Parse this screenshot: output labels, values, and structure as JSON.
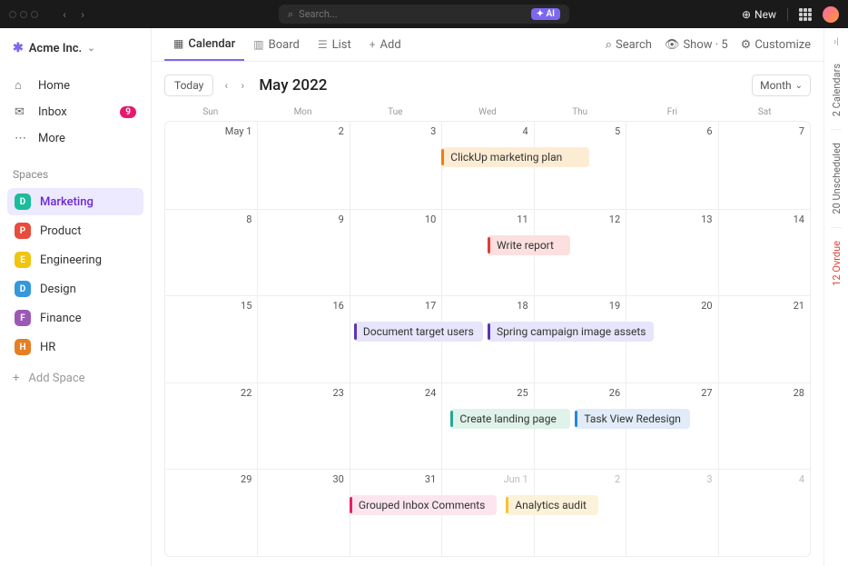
{
  "titlebar": {
    "search_placeholder": "Search...",
    "ai_label": "AI",
    "new_label": "New"
  },
  "workspace": {
    "name": "Acme Inc."
  },
  "sidebar": {
    "nav": [
      {
        "icon": "home",
        "label": "Home"
      },
      {
        "icon": "inbox",
        "label": "Inbox",
        "badge": "9"
      },
      {
        "icon": "more",
        "label": "More"
      }
    ],
    "section_label": "Spaces",
    "spaces": [
      {
        "letter": "D",
        "color": "#1abc9c",
        "label": "Marketing",
        "active": true
      },
      {
        "letter": "P",
        "color": "#e74c3c",
        "label": "Product"
      },
      {
        "letter": "E",
        "color": "#f1c40f",
        "label": "Engineering"
      },
      {
        "letter": "D",
        "color": "#3498db",
        "label": "Design"
      },
      {
        "letter": "F",
        "color": "#9b59b6",
        "label": "Finance"
      },
      {
        "letter": "H",
        "color": "#e67e22",
        "label": "HR"
      }
    ],
    "add_space": "Add Space"
  },
  "views": {
    "tabs": [
      {
        "icon": "calendar",
        "label": "Calendar",
        "active": true
      },
      {
        "icon": "board",
        "label": "Board"
      },
      {
        "icon": "list",
        "label": "List"
      },
      {
        "icon": "plus",
        "label": "Add"
      }
    ],
    "right": [
      {
        "icon": "search",
        "label": "Search"
      },
      {
        "icon": "show",
        "label": "Show · 5"
      },
      {
        "icon": "gear",
        "label": "Customize"
      }
    ]
  },
  "calendar": {
    "today": "Today",
    "title": "May 2022",
    "month_selector": "Month",
    "days": [
      "Sun",
      "Mon",
      "Tue",
      "Wed",
      "Thu",
      "Fri",
      "Sat"
    ],
    "weeks": [
      {
        "cells": [
          "May 1",
          "2",
          "3",
          "4",
          "5",
          "6",
          "7"
        ],
        "events": [
          {
            "label": "ClickUp marketing plan",
            "start": 3,
            "span": 1.6,
            "bg": "#fdecd4",
            "bar": "#f57c00"
          }
        ]
      },
      {
        "cells": [
          "8",
          "9",
          "10",
          "11",
          "12",
          "13",
          "14"
        ],
        "events": [
          {
            "label": "Write report",
            "start": 3.5,
            "span": 0.9,
            "bg": "#fbe0df",
            "bar": "#e53935"
          }
        ]
      },
      {
        "cells": [
          "15",
          "16",
          "17",
          "18",
          "19",
          "20",
          "21"
        ],
        "events": [
          {
            "label": "Document target users",
            "start": 2.05,
            "span": 1.4,
            "bg": "#e7e5fb",
            "bar": "#5e35b1"
          },
          {
            "label": "Spring campaign image assets",
            "start": 3.5,
            "span": 1.8,
            "bg": "#e7e5fb",
            "bar": "#5e35b1"
          }
        ]
      },
      {
        "cells": [
          "22",
          "23",
          "24",
          "25",
          "26",
          "27",
          "28"
        ],
        "events": [
          {
            "label": "Create landing page",
            "start": 3.1,
            "span": 1.3,
            "bg": "#dff3ea",
            "bar": "#26a69a"
          },
          {
            "label": "Task View Redesign",
            "start": 4.45,
            "span": 1.25,
            "bg": "#e1ecf8",
            "bar": "#1e88e5"
          }
        ]
      },
      {
        "cells": [
          "29",
          "30",
          "31",
          "Jun 1",
          "2",
          "3",
          "4"
        ],
        "other": [
          false,
          false,
          false,
          true,
          true,
          true,
          true
        ],
        "events": [
          {
            "label": "Grouped Inbox Comments",
            "start": 2.0,
            "span": 1.6,
            "bg": "#fce5ee",
            "bar": "#e91e63"
          },
          {
            "label": "Analytics audit",
            "start": 3.7,
            "span": 1.0,
            "bg": "#fcf2d9",
            "bar": "#fbc02d"
          }
        ]
      }
    ]
  },
  "rightpanel": {
    "tabs": [
      {
        "label": "2 Calendars"
      },
      {
        "label": "20 Unscheduled"
      },
      {
        "label": "12 Ovrdue",
        "red": true
      }
    ]
  }
}
